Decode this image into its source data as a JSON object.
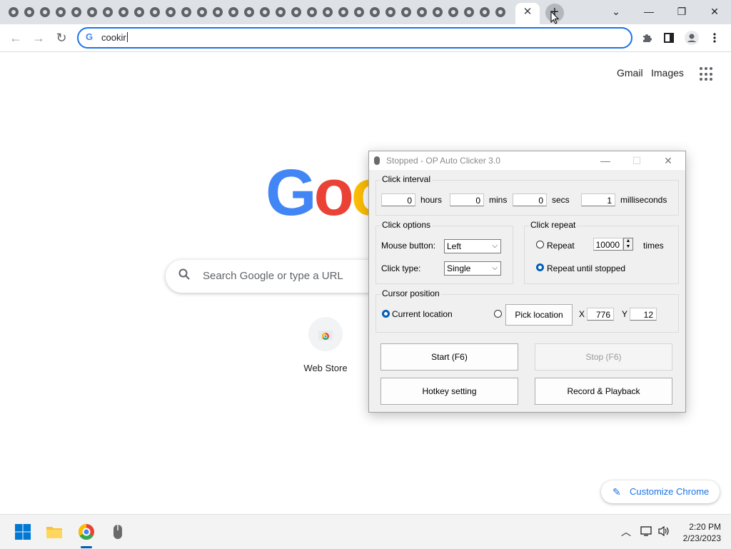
{
  "browser": {
    "background_tab_count": 32,
    "active_tab_close": "✕",
    "new_tab_button": "+",
    "window_controls": {
      "tab_search": "⌄",
      "minimize": "—",
      "restore": "❐",
      "close": "✕"
    },
    "omnibox": {
      "text": "cookir"
    },
    "toolbar_icons": {
      "extensions": "puzzle-icon",
      "side_panel": "side-panel-icon",
      "profile": "profile-icon",
      "menu": "kebab-menu-icon"
    }
  },
  "ntp": {
    "gmail": "Gmail",
    "images": "Images",
    "logo": "Goog",
    "search_placeholder": "Search Google or type a URL",
    "shortcut_label": "Web Store",
    "customize_label": "Customize Chrome"
  },
  "dialog": {
    "title": "Stopped - OP Auto Clicker 3.0",
    "click_interval": {
      "label": "Click interval",
      "hours": "0",
      "hours_label": "hours",
      "mins": "0",
      "mins_label": "mins",
      "secs": "0",
      "secs_label": "secs",
      "ms": "1",
      "ms_label": "milliseconds"
    },
    "click_options": {
      "label": "Click options",
      "mouse_button_label": "Mouse button:",
      "mouse_button_value": "Left",
      "click_type_label": "Click type:",
      "click_type_value": "Single"
    },
    "click_repeat": {
      "label": "Click repeat",
      "repeat_label": "Repeat",
      "repeat_value": "10000",
      "times_label": "times",
      "until_stopped_label": "Repeat until stopped"
    },
    "cursor_position": {
      "label": "Cursor position",
      "current_label": "Current location",
      "pick_label": "Pick location",
      "x_label": "X",
      "x_value": "776",
      "y_label": "Y",
      "y_value": "12"
    },
    "buttons": {
      "start": "Start (F6)",
      "stop": "Stop (F6)",
      "hotkey": "Hotkey setting",
      "record": "Record & Playback"
    }
  },
  "taskbar": {
    "time": "2:20 PM",
    "date": "2/23/2023"
  },
  "colors": {
    "google_blue": "#4285f4",
    "google_red": "#ea4335",
    "google_yellow": "#fbbc05",
    "accent": "#1a73e8",
    "windows_blue": "#005fb8"
  }
}
